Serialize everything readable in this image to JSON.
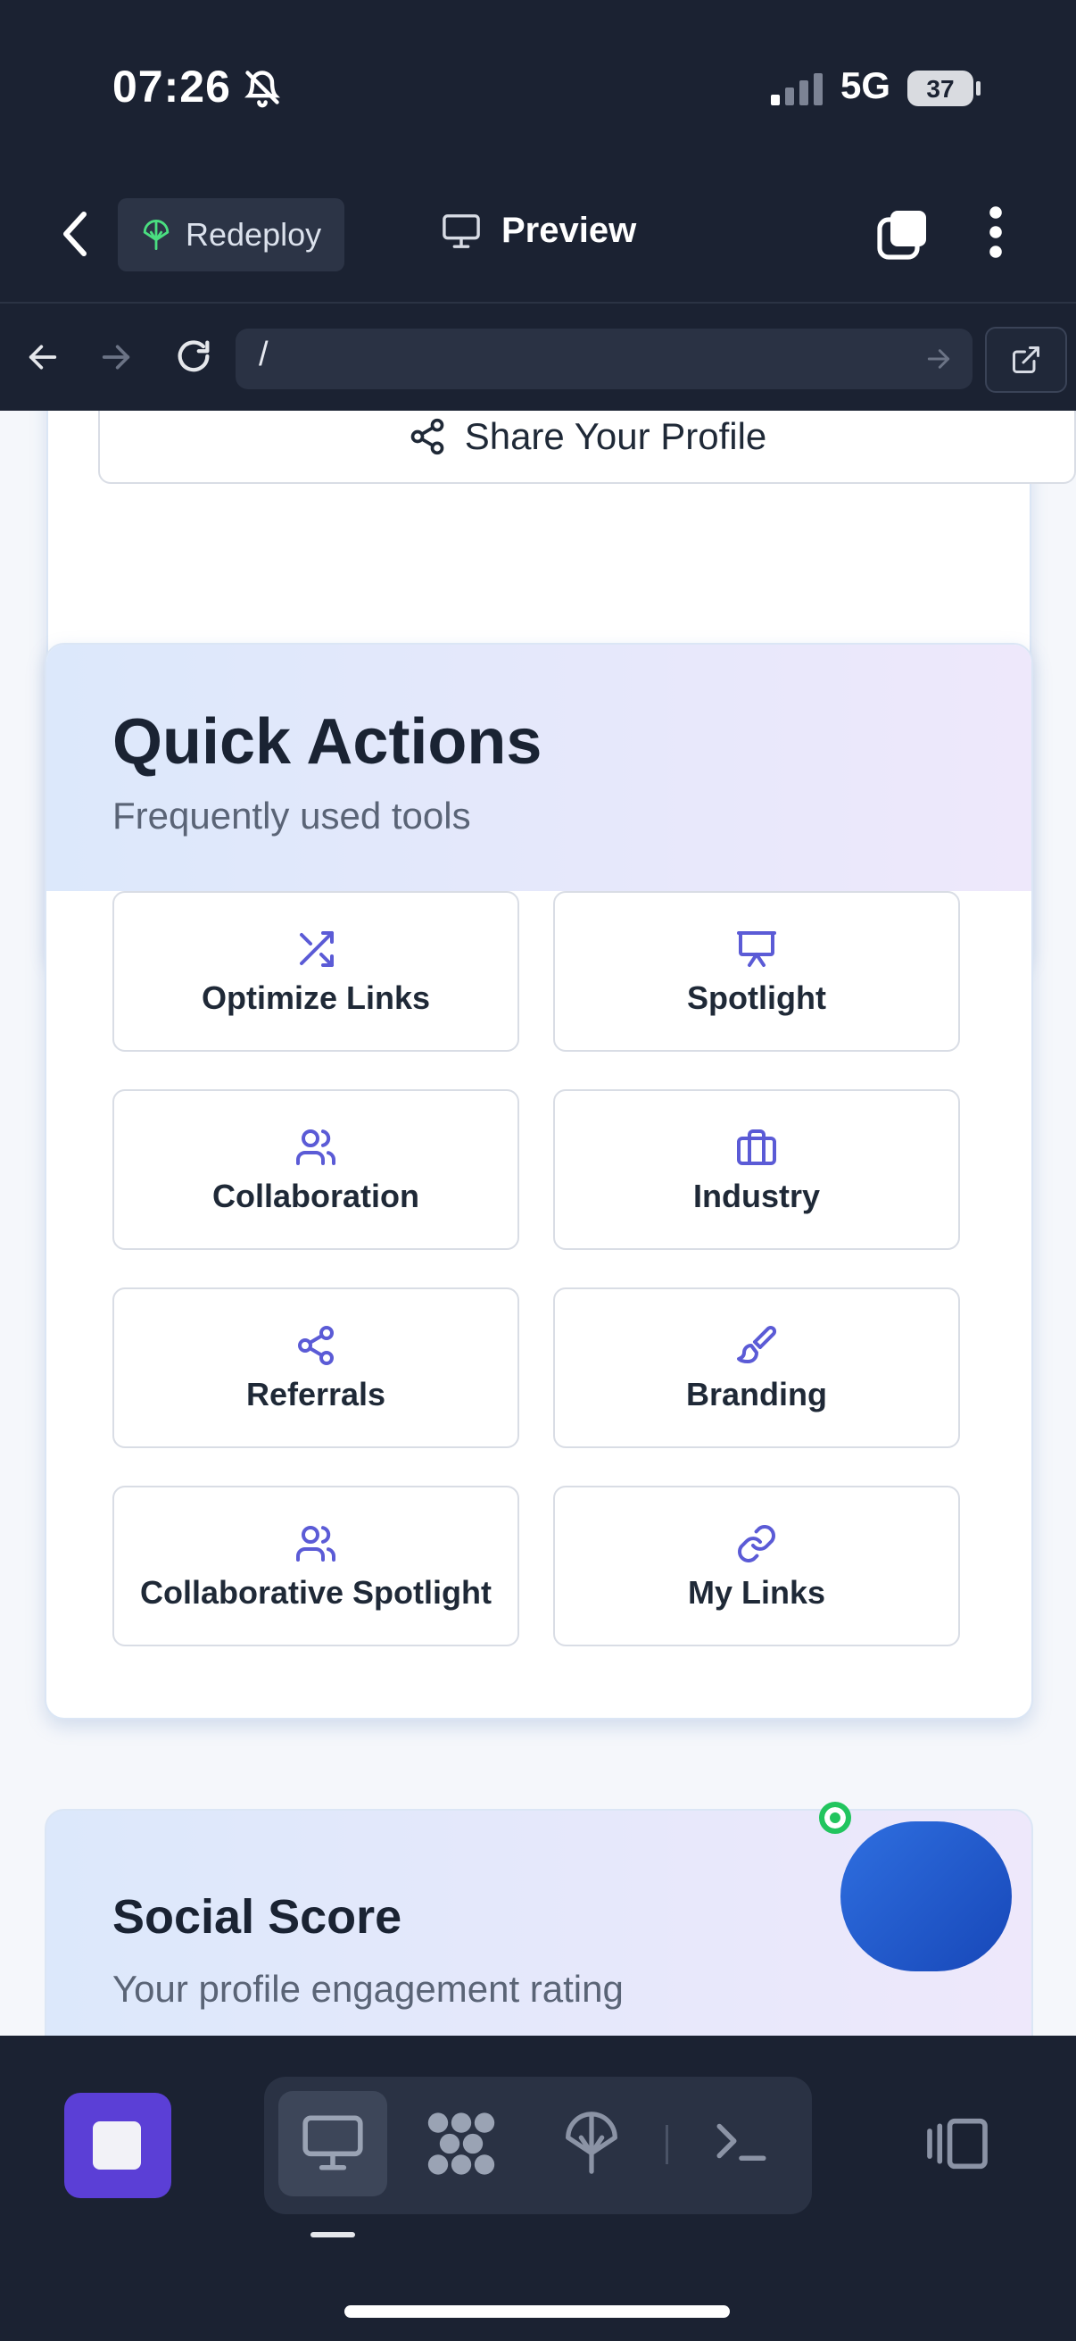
{
  "status_bar": {
    "time": "07:26",
    "network": "5G",
    "battery": "37"
  },
  "app_bar": {
    "redeploy_label": "Redeploy",
    "preview_label": "Preview"
  },
  "browser": {
    "url": "/"
  },
  "share": {
    "label": "Share Your Profile"
  },
  "quick_actions": {
    "title": "Quick Actions",
    "subtitle": "Frequently used tools",
    "items": [
      {
        "label": "Optimize Links",
        "icon": "shuffle-icon"
      },
      {
        "label": "Spotlight",
        "icon": "presentation-icon"
      },
      {
        "label": "Collaboration",
        "icon": "users-icon"
      },
      {
        "label": "Industry",
        "icon": "briefcase-icon"
      },
      {
        "label": "Referrals",
        "icon": "share-icon"
      },
      {
        "label": "Branding",
        "icon": "paintbrush-icon"
      },
      {
        "label": "Collaborative Spotlight",
        "icon": "users-icon"
      },
      {
        "label": "My Links",
        "icon": "link-icon"
      }
    ]
  },
  "social_score": {
    "title": "Social Score",
    "subtitle": "Your profile engagement rating"
  },
  "colors": {
    "accent": "#5b5bd6",
    "stop_button": "#5b3fd6",
    "fab": "#2f6fe0",
    "online": "#22c55e"
  }
}
